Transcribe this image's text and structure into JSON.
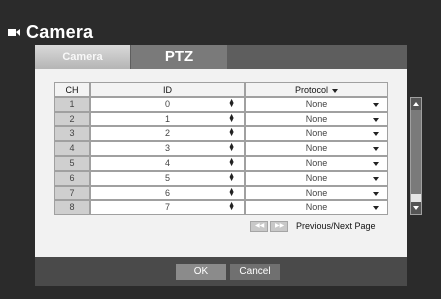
{
  "window": {
    "title": "Camera"
  },
  "tabs": [
    {
      "label": "Camera",
      "active": false
    },
    {
      "label": "PTZ",
      "active": true
    }
  ],
  "table": {
    "headers": {
      "ch": "CH",
      "id": "ID",
      "protocol": "Protocol"
    },
    "rows": [
      {
        "ch": "1",
        "id": "0",
        "protocol": "None"
      },
      {
        "ch": "2",
        "id": "1",
        "protocol": "None"
      },
      {
        "ch": "3",
        "id": "2",
        "protocol": "None"
      },
      {
        "ch": "4",
        "id": "3",
        "protocol": "None"
      },
      {
        "ch": "5",
        "id": "4",
        "protocol": "None"
      },
      {
        "ch": "6",
        "id": "5",
        "protocol": "None"
      },
      {
        "ch": "7",
        "id": "6",
        "protocol": "None"
      },
      {
        "ch": "8",
        "id": "7",
        "protocol": "None"
      }
    ]
  },
  "pager": {
    "label": "Previous/Next Page",
    "prev_glyph": "◀◀",
    "next_glyph": "▶▶"
  },
  "footer": {
    "ok_label": "OK",
    "cancel_label": "Cancel"
  },
  "colors": {
    "background": "#2b2b2b",
    "panel": "#f2f2f2",
    "accent": "#7a7a7a"
  }
}
